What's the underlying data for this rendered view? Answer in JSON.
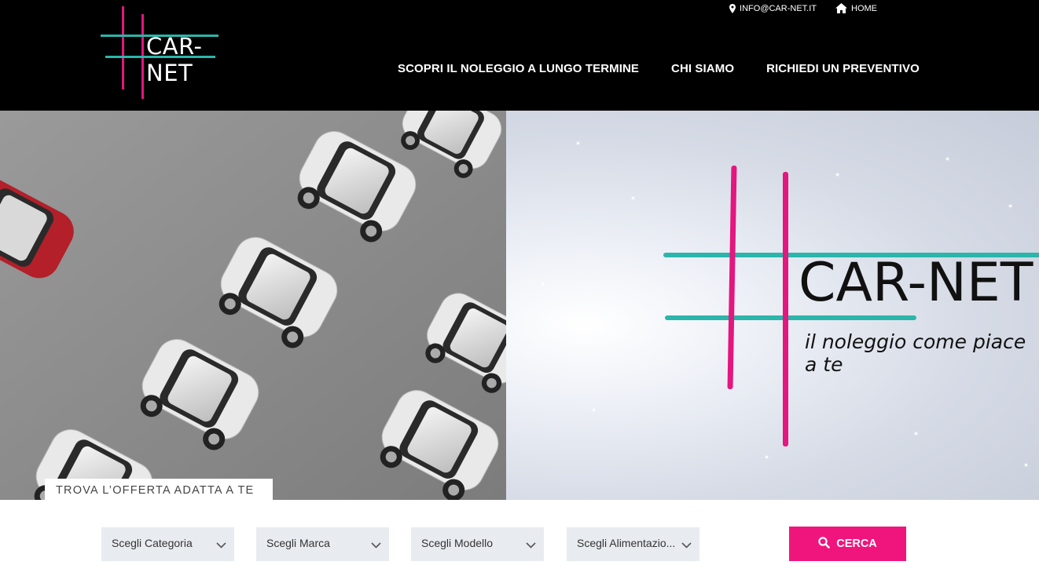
{
  "header": {
    "brand": "CAR-NET",
    "topbar": {
      "email": "INFO@CAR-NET.IT",
      "home": "HOME"
    },
    "nav": [
      {
        "label": "SCOPRI IL NOLEGGIO A LUNGO TERMINE"
      },
      {
        "label": "CHI SIAMO"
      },
      {
        "label": "RICHIEDI UN PREVENTIVO"
      }
    ]
  },
  "hero": {
    "offer_tab": "TROVA L’OFFERTA ADATTA A TE",
    "banner_brand": "CAR-NET",
    "banner_tagline": "il noleggio come piace a te"
  },
  "search": {
    "selects": [
      {
        "label": "Scegli Categoria"
      },
      {
        "label": "Scegli Marca"
      },
      {
        "label": "Scegli Modello"
      },
      {
        "label": "Scegli Alimentazio..."
      }
    ],
    "button": "CERCA"
  },
  "colors": {
    "accent_pink": "#f0157d",
    "accent_teal": "#2bb5ab",
    "header_bg": "#000000"
  },
  "icons": [
    "map-marker-icon",
    "home-icon",
    "search-icon",
    "chevron-down-icon"
  ]
}
